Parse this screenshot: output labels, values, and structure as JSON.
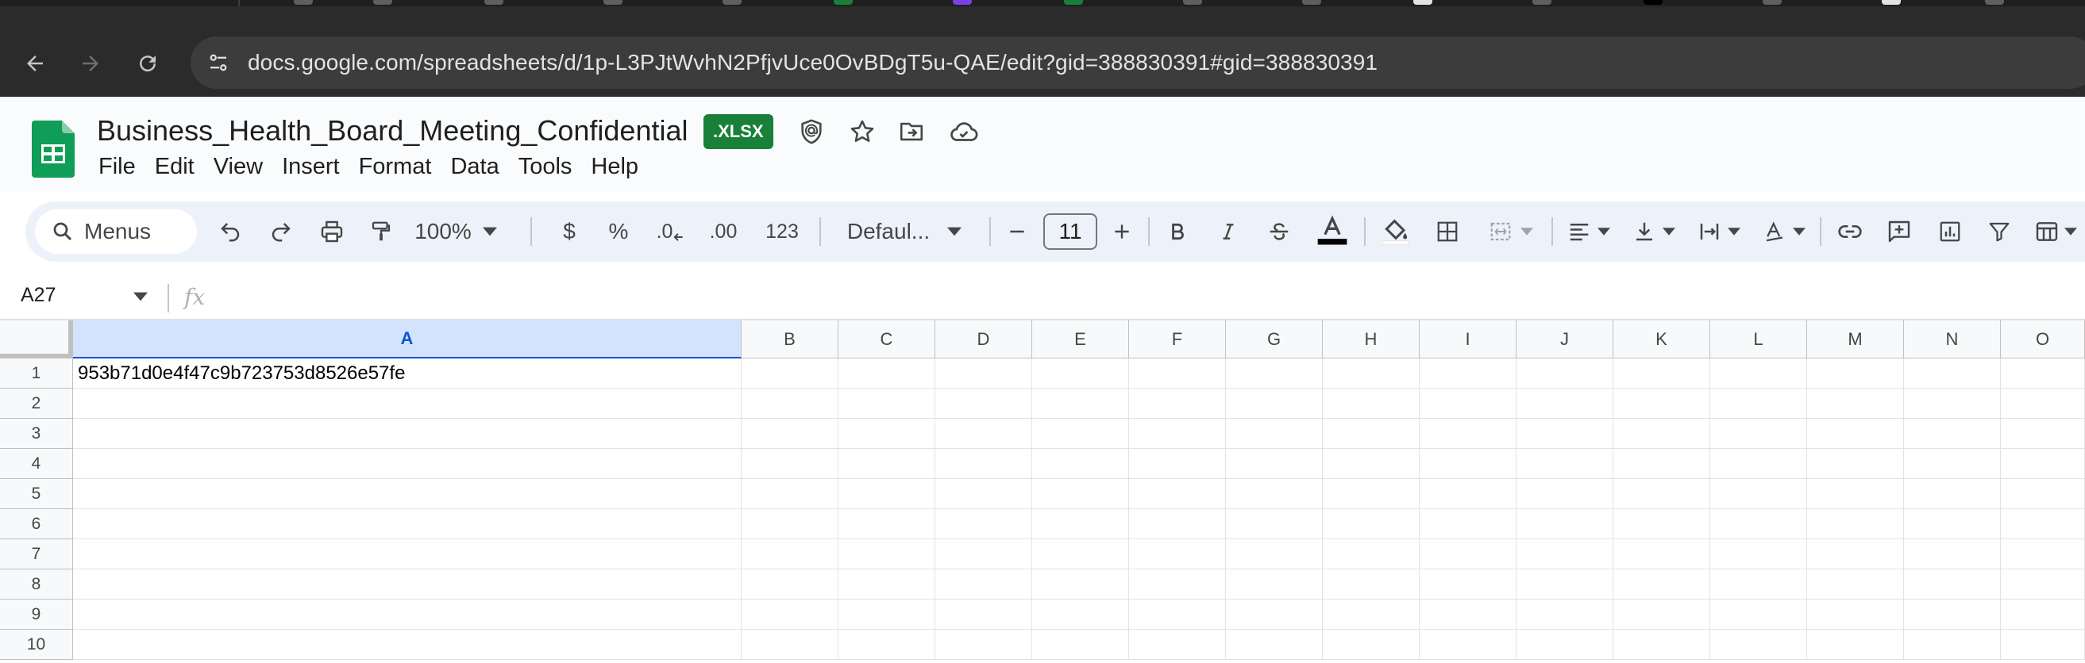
{
  "browser": {
    "url": "docs.google.com/spreadsheets/d/1p-L3PJtWvhN2PfjvUce0OvBDgT5u-QAE/edit?gid=388830391#gid=388830391"
  },
  "document": {
    "title": "Business_Health_Board_Meeting_Confidential",
    "format_badge": ".XLSX"
  },
  "menubar": {
    "items": [
      "File",
      "Edit",
      "View",
      "Insert",
      "Format",
      "Data",
      "Tools",
      "Help"
    ]
  },
  "toolbar": {
    "search_label": "Menus",
    "zoom": "100%",
    "currency_label": "$",
    "percent_label": "%",
    "decrease_decimals_label": ".0",
    "increase_decimals_label": ".00",
    "number_format_label": "123",
    "font_family": "Defaul...",
    "font_size": "11"
  },
  "formula_bar": {
    "name_box": "A27",
    "fx_label": "fx",
    "content": ""
  },
  "grid": {
    "columns": [
      "A",
      "B",
      "C",
      "D",
      "E",
      "F",
      "G",
      "H",
      "I",
      "J",
      "K",
      "L",
      "M",
      "N",
      "O"
    ],
    "selected_column": "A",
    "rows": [
      {
        "num": "1",
        "a": "953b71d0e4f47c9b723753d8526e57fe"
      },
      {
        "num": "2",
        "a": ""
      },
      {
        "num": "3",
        "a": ""
      },
      {
        "num": "4",
        "a": ""
      },
      {
        "num": "5",
        "a": ""
      },
      {
        "num": "6",
        "a": ""
      },
      {
        "num": "7",
        "a": ""
      },
      {
        "num": "8",
        "a": ""
      },
      {
        "num": "9",
        "a": ""
      },
      {
        "num": "10",
        "a": ""
      }
    ]
  },
  "colors": {
    "sheets_green": "#0f9d58",
    "badge_green": "#188038",
    "selection_blue": "#0b57d0",
    "selection_header_bg": "#d3e3fd",
    "toolbar_bg": "#edf2fa",
    "chrome_dark": "#2b2b2b"
  },
  "icons": {
    "back": "arrow-left-icon",
    "forward": "arrow-right-icon",
    "reload": "reload-icon",
    "site_info": "tune-icon",
    "security": "shield-icon",
    "star": "star-icon",
    "move": "folder-move-icon",
    "cloud": "cloud-done-icon"
  }
}
